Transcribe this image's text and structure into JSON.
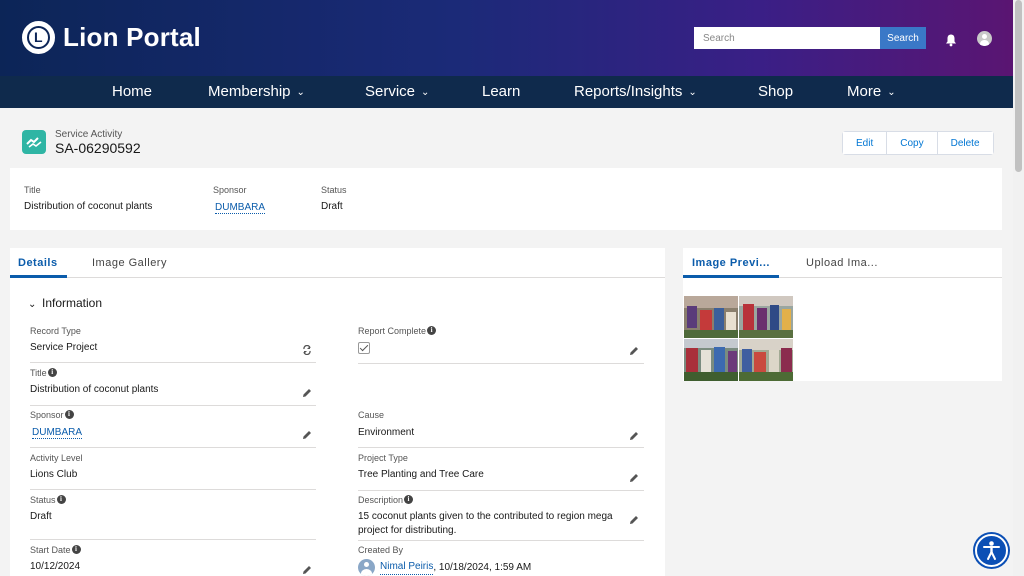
{
  "header": {
    "brand": "Lion Portal",
    "search_placeholder": "Search",
    "search_button": "Search"
  },
  "nav": {
    "items": [
      {
        "label": "Home",
        "has_dropdown": false
      },
      {
        "label": "Membership",
        "has_dropdown": true
      },
      {
        "label": "Service",
        "has_dropdown": true
      },
      {
        "label": "Learn",
        "has_dropdown": false
      },
      {
        "label": "Reports/Insights",
        "has_dropdown": true
      },
      {
        "label": "Shop",
        "has_dropdown": false
      },
      {
        "label": "More",
        "has_dropdown": true
      }
    ]
  },
  "record": {
    "object_type": "Service Activity",
    "number": "SA-06290592",
    "actions": [
      "Edit",
      "Copy",
      "Delete"
    ]
  },
  "highlights": {
    "title_label": "Title",
    "title_value": "Distribution of coconut plants",
    "sponsor_label": "Sponsor",
    "sponsor_value": "DUMBARA",
    "status_label": "Status",
    "status_value": "Draft"
  },
  "details": {
    "tabs": [
      "Details",
      "Image Gallery"
    ],
    "section": "Information",
    "fields": {
      "record_type": {
        "label": "Record Type",
        "value": "Service Project"
      },
      "report_complete": {
        "label": "Report Complete",
        "checked": true
      },
      "title": {
        "label": "Title",
        "value": "Distribution of coconut plants"
      },
      "sponsor": {
        "label": "Sponsor",
        "value": "DUMBARA"
      },
      "cause": {
        "label": "Cause",
        "value": "Environment"
      },
      "activity_level": {
        "label": "Activity Level",
        "value": "Lions Club"
      },
      "project_type": {
        "label": "Project Type",
        "value": "Tree Planting and Tree Care"
      },
      "status": {
        "label": "Status",
        "value": "Draft"
      },
      "description": {
        "label": "Description",
        "value": "15 coconut plants given to the contributed to region mega project for distributing."
      },
      "start_date": {
        "label": "Start Date",
        "value": "10/12/2024"
      },
      "created_by": {
        "label": "Created By",
        "user": "Nimal Peiris",
        "timestamp": ", 10/18/2024, 1:59 AM"
      }
    }
  },
  "side": {
    "tabs": [
      "Image Previ...",
      "Upload Ima..."
    ]
  },
  "colors": {
    "nav_bg": "#0f2a4c",
    "accent": "#0b5cab",
    "record_icon": "#2fb5a4"
  }
}
